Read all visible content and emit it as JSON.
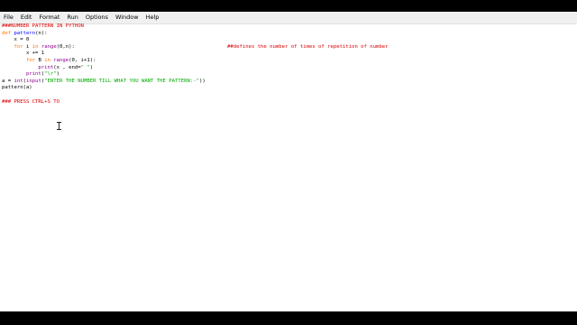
{
  "menubar": {
    "items": [
      "File",
      "Edit",
      "Format",
      "Run",
      "Options",
      "Window",
      "Help"
    ]
  },
  "code": {
    "line1": "###NUMBER PATTERN IN PYTHON",
    "line2_kw": "def",
    "line2_name": "pattern",
    "line2_rest": "(n):",
    "line3": "    x = 0",
    "line4_kw1": "for",
    "line4_var": "i",
    "line4_kw2": "in",
    "line4_builtin": "range",
    "line4_rest": "(0,n):",
    "line4_comment": "##defines the number of times of repetition of number",
    "line5": "        x += 1",
    "line6_kw1": "for",
    "line6_var": "B",
    "line6_kw2": "in",
    "line6_builtin": "range",
    "line6_rest": "(0, i+1):",
    "line7_builtin": "print",
    "line7_rest": "(x , end=",
    "line7_str": "\" \"",
    "line7_close": ")",
    "line8_builtin": "print",
    "line8_open": "(",
    "line8_str": "\"\\r\"",
    "line8_close": ")",
    "line9_pre": "a = ",
    "line9_builtin1": "int",
    "line9_open1": "(",
    "line9_builtin2": "input",
    "line9_open2": "(",
    "line9_str": "\"ENTER THE NUMBER TILL WHAT YOU WANT THE PATTERN:-\"",
    "line9_close": "))",
    "line10": "pattern(a)",
    "line11": "",
    "line12": "### PRESS CTRL+S TO"
  },
  "colors": {
    "comment": "#dd0000",
    "keyword": "#ff7700",
    "definition": "#0000ff",
    "builtin": "#900090",
    "string": "#00aa00"
  }
}
